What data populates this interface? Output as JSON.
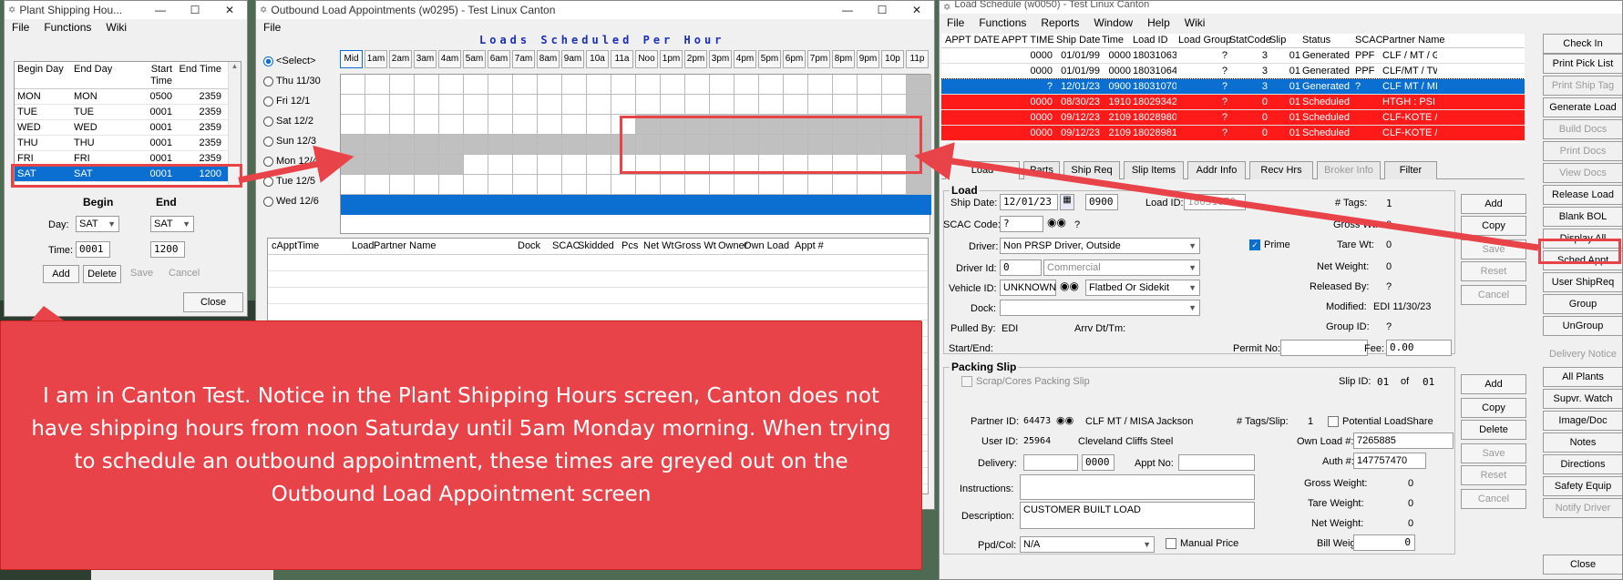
{
  "shipping_hours": {
    "title": "Plant Shipping Hou...",
    "menu": [
      "File",
      "Functions",
      "Wiki"
    ],
    "cols": [
      "Begin Day",
      "End Day",
      "Start Time",
      "End Time"
    ],
    "rows": [
      [
        "MON",
        "MON",
        "0500",
        "2359"
      ],
      [
        "TUE",
        "TUE",
        "0001",
        "2359"
      ],
      [
        "WED",
        "WED",
        "0001",
        "2359"
      ],
      [
        "THU",
        "THU",
        "0001",
        "2359"
      ],
      [
        "FRI",
        "FRI",
        "0001",
        "2359"
      ],
      [
        "SAT",
        "SAT",
        "0001",
        "1200"
      ]
    ],
    "begin_label": "Begin",
    "end_label": "End",
    "day_label": "Day:",
    "time_label": "Time:",
    "begin_day": "SAT",
    "end_day": "SAT",
    "begin_time": "0001",
    "end_time": "1200",
    "add": "Add",
    "delete": "Delete",
    "save": "Save",
    "cancel": "Cancel",
    "close": "Close"
  },
  "outbound": {
    "title": "Outbound Load Appointments (w0295) - Test Linux Canton",
    "menu": "File",
    "heading": "Loads Scheduled Per Hour",
    "hours": [
      "Mid",
      "1am",
      "2am",
      "3am",
      "4am",
      "5am",
      "6am",
      "7am",
      "8am",
      "9am",
      "10a",
      "11a",
      "Noo",
      "1pm",
      "2pm",
      "3pm",
      "4pm",
      "5pm",
      "6pm",
      "7pm",
      "8pm",
      "9pm",
      "10p",
      "11p"
    ],
    "days": [
      "<Select>",
      "Thu 11/30",
      "Fri 12/1",
      "Sat 12/2",
      "Sun 12/3",
      "Mon 12/4",
      "Tue 12/5",
      "Wed 12/6"
    ],
    "list_cols": [
      "cApptTime",
      "Load",
      "Partner Name",
      "Dock",
      "SCAC",
      "Skidded",
      "Pcs",
      "Net Wt",
      "Gross Wt",
      "Owner",
      "Own Load",
      "Appt #"
    ]
  },
  "load_schedule": {
    "title": "Load Schedule (w0050) - Test Linux Canton",
    "menu": [
      "File",
      "Functions",
      "Reports",
      "Window",
      "Help",
      "Wiki"
    ],
    "cols": [
      "APPT DATE",
      "APPT TIME",
      "Ship Date",
      "Time",
      "Load ID",
      "Load Group",
      "StatCode",
      "Slip",
      "Status",
      "SCAC",
      "Partner Name"
    ],
    "rows": [
      [
        "",
        "0000",
        "01/01/99",
        "0000",
        "18031063",
        "?",
        "3",
        "01",
        "Generated",
        "PPF",
        "CLF / MT / Gr"
      ],
      [
        "",
        "0000",
        "01/01/99",
        "0000",
        "18031064",
        "?",
        "3",
        "01",
        "Generated",
        "PPF",
        "CLF/MT / TW"
      ],
      [
        "",
        "?",
        "12/01/23",
        "0900",
        "18031070",
        "?",
        "3",
        "01",
        "Generated",
        "?",
        "CLF MT / MIS"
      ],
      [
        "",
        "0000",
        "08/30/23",
        "1910",
        "18029342",
        "?",
        "0",
        "01",
        "Scheduled",
        "",
        "HTGH : PSI Ke"
      ],
      [
        "",
        "0000",
        "09/12/23",
        "2109",
        "18028980",
        "?",
        "0",
        "01",
        "Scheduled",
        "",
        "CLF-KOTE / K"
      ],
      [
        "",
        "0000",
        "09/12/23",
        "2109",
        "18028981",
        "?",
        "0",
        "01",
        "Scheduled",
        "",
        "CLF-KOTE / K"
      ]
    ],
    "tabs": [
      "Load",
      "Parts",
      "Ship Req",
      "Slip Items",
      "Addr Info",
      "Recv Hrs",
      "Broker Info",
      "Filter"
    ],
    "load": {
      "group_title": "Load",
      "ship_date_label": "Ship Date:",
      "ship_date": "12/01/23",
      "ship_time": "0900",
      "load_id_label": "Load ID:",
      "load_id": "18031070",
      "tags_label": "# Tags:",
      "tags": "1",
      "scac_label": "SCAC Code:",
      "scac": "?",
      "scac_q": "?",
      "gross_label": "Gross Wt:",
      "gross": "0",
      "driver_label": "Driver:",
      "driver": "Non PRSP Driver, Outside",
      "prime": "Prime",
      "tare_label": "Tare Wt:",
      "tare": "0",
      "driver_id_label": "Driver Id:",
      "driver_id": "0",
      "commercial": "Commercial",
      "net_label": "Net Weight:",
      "net": "0",
      "vehicle_label": "Vehicle ID:",
      "vehicle": "UNKNOWN",
      "vehicle_type": "Flatbed Or Sidekit",
      "released_label": "Released By:",
      "released": "?",
      "dock_label": "Dock:",
      "modified_label": "Modified:",
      "modified": "EDI 11/30/23",
      "pulled_label": "Pulled By:",
      "pulled": "EDI",
      "arrv_label": "Arrv Dt/Tm:",
      "group_label": "Group ID:",
      "group": "?",
      "start_end_label": "Start/End:",
      "permit_label": "Permit No:",
      "fee_label": "Fee:",
      "fee": "0.00",
      "btn_add": "Add",
      "btn_copy": "Copy",
      "btn_save": "Save",
      "btn_reset": "Reset",
      "btn_cancel": "Cancel"
    },
    "slip": {
      "group_title": "Packing Slip",
      "scrap": "Scrap/Cores Packing Slip",
      "slip_id_label": "Slip ID:",
      "slip_id": "01",
      "of": "of",
      "slip_total": "01",
      "partner_label": "Partner ID:",
      "partner_id": "64473",
      "partner_name": "CLF MT / MISA Jackson",
      "tags_label": "# Tags/Slip:",
      "tags": "1",
      "potential": "Potential LoadShare",
      "user_label": "User ID:",
      "user_id": "25964",
      "user_name": "Cleveland Cliffs Steel",
      "own_load_label": "Own Load #:",
      "own_load": "7265885",
      "delivery_label": "Delivery:",
      "delivery_time": "0000",
      "appt_label": "Appt No:",
      "auth_label": "Auth #:",
      "auth": "147757470",
      "instructions_label": "Instructions:",
      "gross_label": "Gross Weight:",
      "gross": "0",
      "description_label": "Description:",
      "description": "CUSTOMER BUILT LOAD",
      "tare_label": "Tare Weight:",
      "tare": "0",
      "net_label": "Net Weight:",
      "net": "0",
      "ppd_label": "Ppd/Col:",
      "ppd": "N/A",
      "manual_price": "Manual Price",
      "bill_label": "Bill Weight:",
      "bill": "0",
      "btn_add": "Add",
      "btn_copy": "Copy",
      "btn_delete": "Delete",
      "btn_save": "Save",
      "btn_reset": "Reset",
      "btn_cancel": "Cancel"
    },
    "right_buttons": [
      "Check In",
      "Print Pick List",
      "Print Ship Tag",
      "Generate Load",
      "Build Docs",
      "Print Docs",
      "View Docs",
      "Release Load",
      "Blank BOL",
      "Display All",
      "Sched Appt",
      "User ShipReq",
      "Group",
      "UnGroup",
      "Delivery Notice",
      "All Plants",
      "Supvr. Watch",
      "Image/Doc",
      "Notes",
      "Directions",
      "Safety Equip",
      "Notify Driver",
      "Close"
    ]
  },
  "callout": {
    "text": "I am in Canton Test. Notice in the Plant Shipping Hours screen, Canton does not have shipping hours from noon Saturday until 5am Monday morning. When trying to schedule an outbound appointment, these times are greyed out on the Outbound Load Appointment screen"
  },
  "colors": {
    "callout": "#e9434a",
    "selection": "#0a6fd1",
    "red_row": "#ff1a1a"
  }
}
